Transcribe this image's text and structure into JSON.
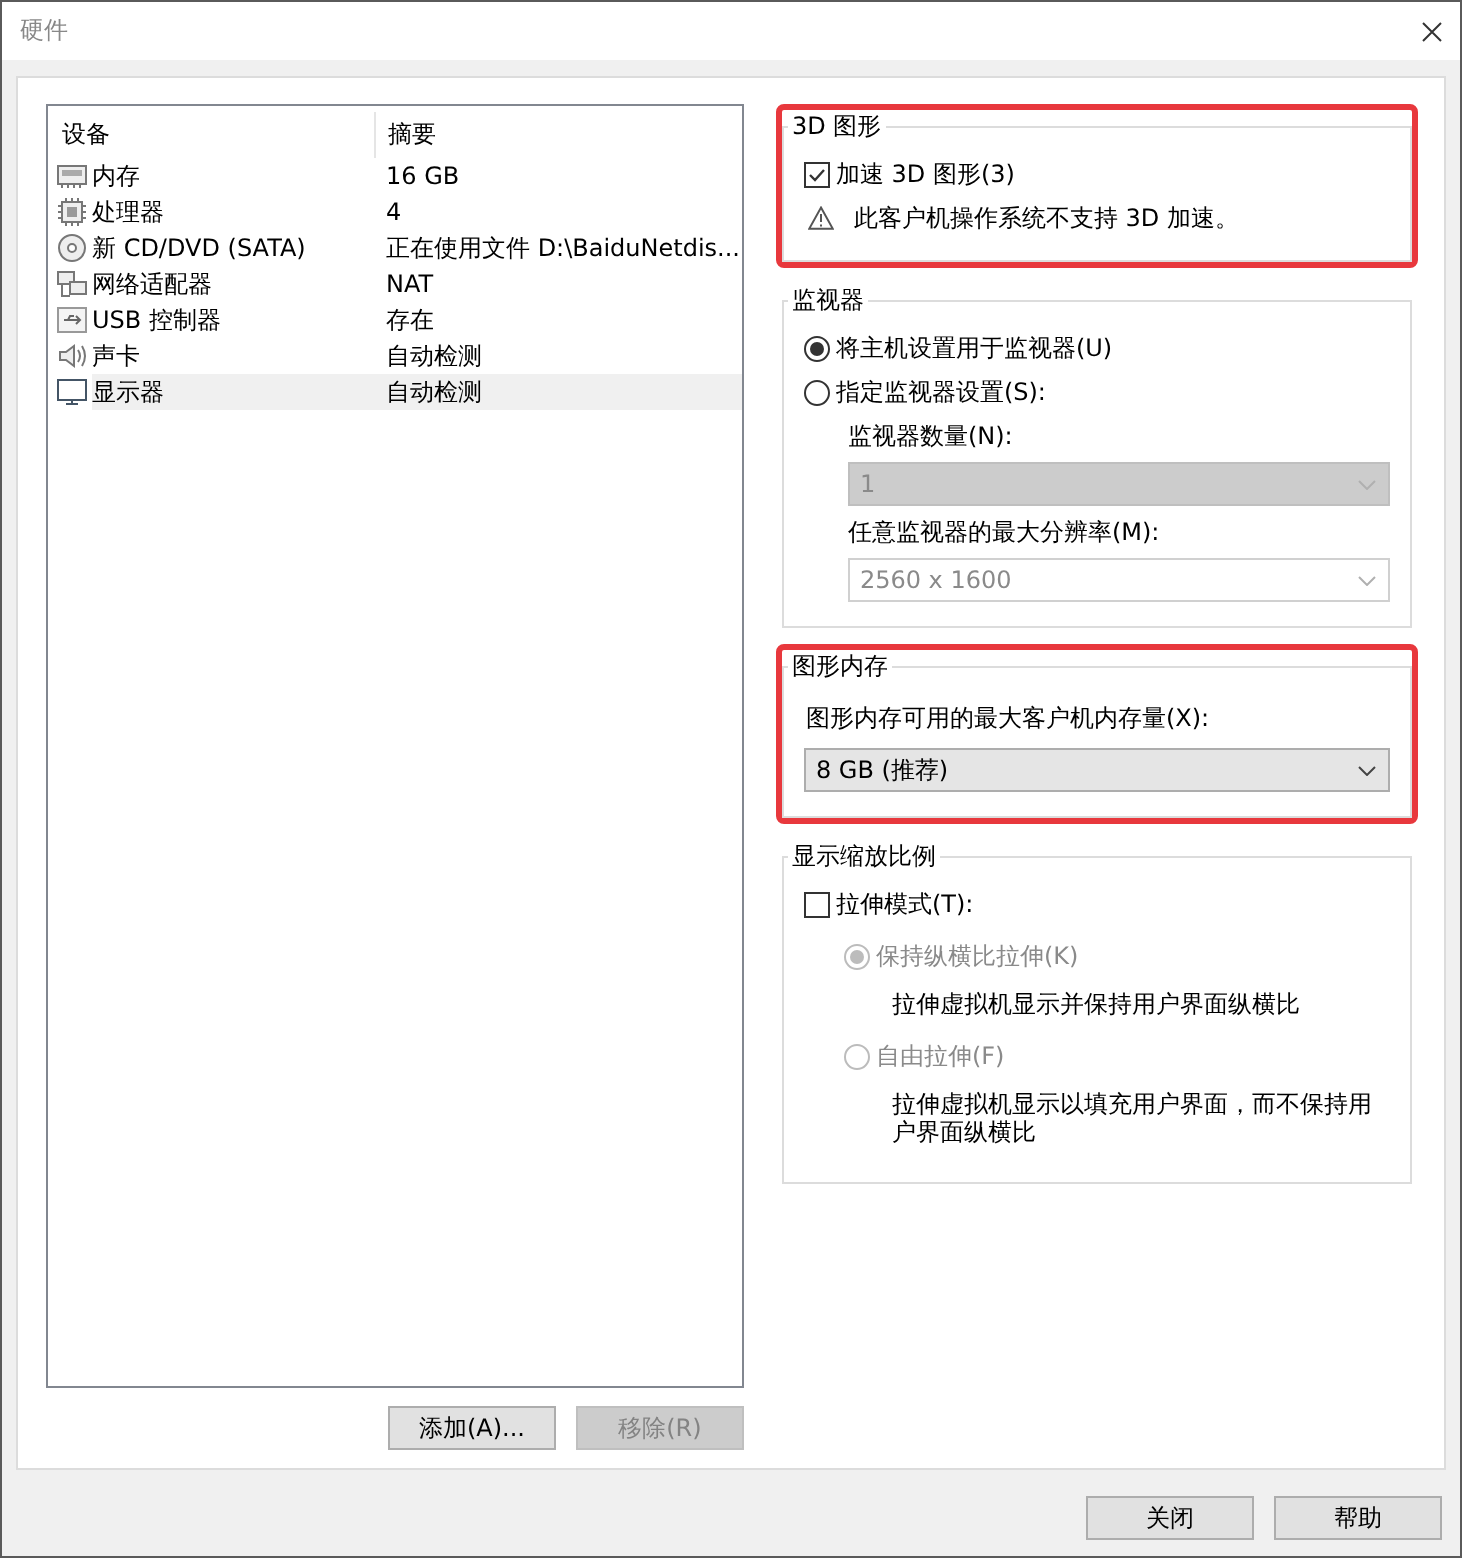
{
  "window": {
    "title": "硬件"
  },
  "devices": {
    "columns": [
      "设备",
      "摘要"
    ],
    "rows": [
      {
        "kind": "memory",
        "name": "内存",
        "summary": "16 GB",
        "selected": false
      },
      {
        "kind": "processor",
        "name": "处理器",
        "summary": "4",
        "selected": false
      },
      {
        "kind": "disc",
        "name": "新 CD/DVD (SATA)",
        "summary": "正在使用文件 D:\\BaiduNetdis...",
        "selected": false
      },
      {
        "kind": "network",
        "name": "网络适配器",
        "summary": "NAT",
        "selected": false
      },
      {
        "kind": "usb",
        "name": "USB 控制器",
        "summary": "存在",
        "selected": false
      },
      {
        "kind": "speaker",
        "name": "声卡",
        "summary": "自动检测",
        "selected": false
      },
      {
        "kind": "monitor",
        "name": "显示器",
        "summary": "自动检测",
        "selected": true
      }
    ]
  },
  "list_buttons": [
    {
      "label": "添加(A)...",
      "disabled": false
    },
    {
      "label": "移除(R)",
      "disabled": true
    }
  ],
  "graphics_3d": {
    "title": "3D 图形",
    "highlighted": true,
    "accelerate": {
      "label": "加速 3D 图形(3)",
      "checked": true
    },
    "warning": "此客户机操作系统不支持 3D 加速。"
  },
  "monitors": {
    "title": "监视器",
    "highlighted": false,
    "options": [
      {
        "label": "将主机设置用于监视器(U)",
        "selected": true
      },
      {
        "label": "指定监视器设置(S):",
        "selected": false
      }
    ],
    "fields": [
      {
        "kind": "dropdown",
        "label": "监视器数量(N):",
        "value": "1",
        "disabled": true
      },
      {
        "kind": "combo",
        "label": "任意监视器的最大分辨率(M):",
        "value": "2560 x 1600",
        "disabled": true
      }
    ]
  },
  "graphics_memory": {
    "title": "图形内存",
    "highlighted": true,
    "label": "图形内存可用的最大客户机内存量(X):",
    "value": "8 GB (推荐)"
  },
  "scaling": {
    "title": "显示缩放比例",
    "highlighted": false,
    "stretch": {
      "label": "拉伸模式(T):",
      "checked": false
    },
    "modes": [
      {
        "label": "保持纵横比拉伸(K)",
        "selected": true,
        "disabled": true,
        "description": "拉伸虚拟机显示并保持用户界面纵横比"
      },
      {
        "label": "自由拉伸(F)",
        "selected": false,
        "disabled": true,
        "description": "拉伸虚拟机显示以填充用户界面，而不保持用户界面纵横比"
      }
    ]
  },
  "footer_buttons": [
    {
      "label": "关闭",
      "disabled": false
    },
    {
      "label": "帮助",
      "disabled": false
    }
  ]
}
